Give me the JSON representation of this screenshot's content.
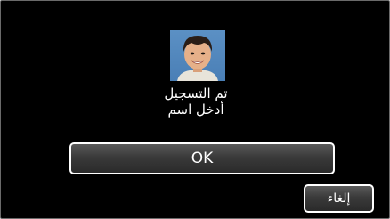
{
  "dialog": {
    "message_line1": "تم التسجيل",
    "message_line2": "أدخل اسم",
    "ok_label": "OK",
    "cancel_label": "إلغاء"
  },
  "colors": {
    "background": "#000000",
    "button_border": "#ffffff",
    "text": "#ffffff"
  },
  "icons": {
    "face_photo": "face-photo-thumbnail"
  }
}
